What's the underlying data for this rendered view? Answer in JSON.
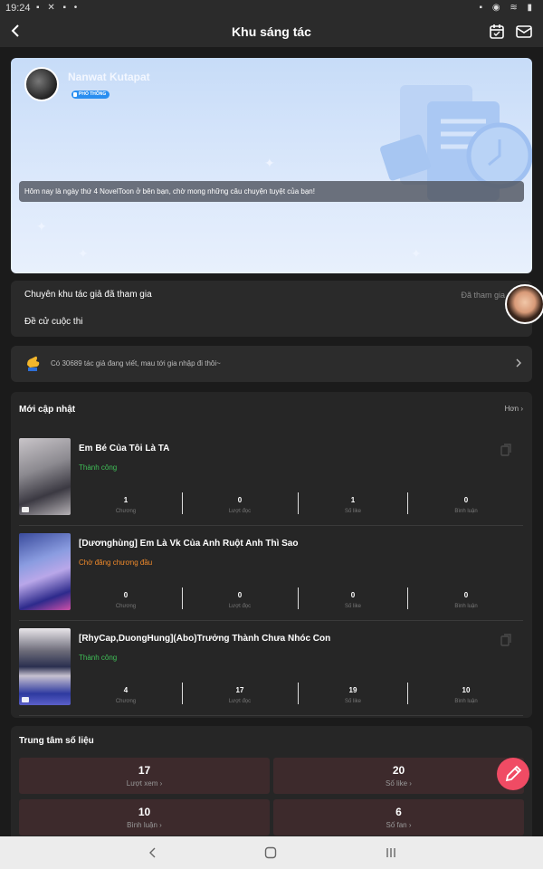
{
  "status_bar": {
    "time": "19:24"
  },
  "app_bar": {
    "title": "Khu sáng tác"
  },
  "profile": {
    "username": "Nanwat Kutapat",
    "badge": "PHỔ THÔNG",
    "welcome": "Hôm nay là ngày thứ 4 NovelToon ở bên bạn, chờ mong những câu chuyện tuyệt của bạn!"
  },
  "contest": {
    "joined_label": "Chuyên khu tác giả đã tham gia",
    "joined_status": "Đã tham gia",
    "nominate_label": "Đề cử cuộc thi"
  },
  "writers_banner": {
    "text": "Có 30689 tác giả đang viết, mau tới gia nhập đi thôi~"
  },
  "updates": {
    "title": "Mới cập nhật",
    "more": "Hơn",
    "stat_labels": [
      "Chương",
      "Lượt đọc",
      "Số like",
      "Bình luận"
    ],
    "stories": [
      {
        "title": "Em Bé Của Tôi Là TA",
        "status": "Thành công",
        "status_color": "#3fbf57",
        "stats": [
          "1",
          "0",
          "1",
          "0"
        ]
      },
      {
        "title": "[Dươnghùng] Em Là Vk Của Anh Ruột Anh Thì Sao",
        "status": "Chờ đăng chương đầu",
        "status_color": "#f08a2b",
        "stats": [
          "0",
          "0",
          "0",
          "0"
        ]
      },
      {
        "title": "[RhyCap,DuongHung](Abo)Trưởng Thành Chưa Nhóc Con",
        "status": "Thành công",
        "status_color": "#3fbf57",
        "stats": [
          "4",
          "17",
          "19",
          "10"
        ]
      }
    ]
  },
  "data_center": {
    "title": "Trung tâm số liệu",
    "cards": [
      {
        "value": "17",
        "label": "Lượt xem"
      },
      {
        "value": "20",
        "label": "Số like"
      },
      {
        "value": "10",
        "label": "Bình luận"
      },
      {
        "value": "6",
        "label": "Số fan"
      }
    ]
  }
}
